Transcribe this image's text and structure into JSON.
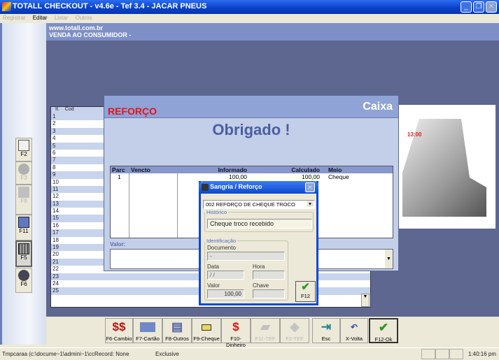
{
  "window": {
    "title": "TOTALL CHECKOUT - v4.6e  - Tef 3.4 - JACAR PNEUS",
    "min": "_",
    "restore": "❐",
    "close": "✕"
  },
  "menu": [
    {
      "label": "Registrar",
      "enabled": false
    },
    {
      "label": "Editar",
      "enabled": true
    },
    {
      "label": "Listar",
      "enabled": false
    },
    {
      "label": "Outros",
      "enabled": false
    }
  ],
  "header": {
    "site": "www.totall.com.br",
    "mode": "VENDA AO CONSUMIDOR  -"
  },
  "side_buttons": [
    {
      "label": "F2",
      "icon": "notepad-icon",
      "enabled": true
    },
    {
      "label": "F3",
      "icon": "cloud-icon",
      "enabled": false
    },
    {
      "label": "F9",
      "icon": "items-icon",
      "enabled": false
    },
    {
      "label": "F11",
      "icon": "document-pen-icon",
      "enabled": true
    },
    {
      "label": "F5",
      "icon": "grid-icon",
      "enabled": true,
      "active": true
    },
    {
      "label": "F6",
      "icon": "key-icon",
      "enabled": true
    }
  ],
  "grid": {
    "columns": [
      "It.",
      "Cod"
    ],
    "rows": [
      "1",
      "2",
      "3",
      "4",
      "5",
      "6",
      "7",
      "8",
      "9",
      "10",
      "11",
      "12",
      "13",
      "14",
      "15",
      "16",
      "17",
      "18",
      "19",
      "20",
      "21",
      "22",
      "23",
      "24",
      "25"
    ]
  },
  "caixa": {
    "operation": "REFORÇO",
    "title": "Caixa",
    "message": "Obrigado !",
    "columns": [
      "Parc",
      "Vencto",
      "Informado",
      "Calculado",
      "Meio"
    ],
    "rows": [
      {
        "parc": "1",
        "vencto": "",
        "informado": "100,00",
        "calculado": "100,00",
        "meio": "Cheque"
      }
    ],
    "valor_label": "Valor:",
    "valor": ""
  },
  "sangria": {
    "title": "Sangria / Reforço",
    "tipo": "002 REFORÇO DE CHEQUE TROCO",
    "historico_label": "Histórico",
    "historico": "Cheque troco recebido",
    "identificacao_label": "Identificação",
    "documento_label": "Documento",
    "documento": " -",
    "data_label": "Data",
    "data": " / /",
    "hora_label": "Hora",
    "hora": " : :",
    "valor_label": "Valor",
    "valor": "100,00",
    "chave_label": "Chave",
    "chave": "",
    "ok_label": "F12"
  },
  "toolbar": [
    {
      "label": "F6-Cambio",
      "icon": "dollar-exchange-icon",
      "enabled": true
    },
    {
      "label": "F7-Cartão",
      "icon": "credit-card-icon",
      "enabled": true
    },
    {
      "label": "F8-Outros",
      "icon": "other-icon",
      "enabled": true
    },
    {
      "label": "F9-Cheque",
      "icon": "check-icon",
      "enabled": true
    },
    {
      "label": "F10-Dinheiro",
      "icon": "dollar-icon",
      "enabled": true
    },
    {
      "label": "F11-TEF",
      "icon": "pos-terminal-icon",
      "enabled": false
    },
    {
      "label": "F2-TEF",
      "icon": "tef-icon",
      "enabled": false
    },
    {
      "label": "Esc",
      "icon": "exit-door-icon",
      "enabled": true
    },
    {
      "label": "X-Volta",
      "icon": "undo-icon",
      "enabled": true
    },
    {
      "label": "F12-Ok",
      "icon": "checkmark-icon",
      "enabled": true
    }
  ],
  "status": {
    "path": "Tmpcaraa (c:\\docume~1\\admini~1\\ccRecord: None",
    "mode": "Exclusive",
    "time": "1:40:16 pm"
  },
  "colors": {
    "title_bar": "#0a3fc8",
    "main_bg": "#5d6790",
    "header": "#7d8fc6",
    "reforco": "#e0141c",
    "ok_green": "#2a9a20"
  }
}
